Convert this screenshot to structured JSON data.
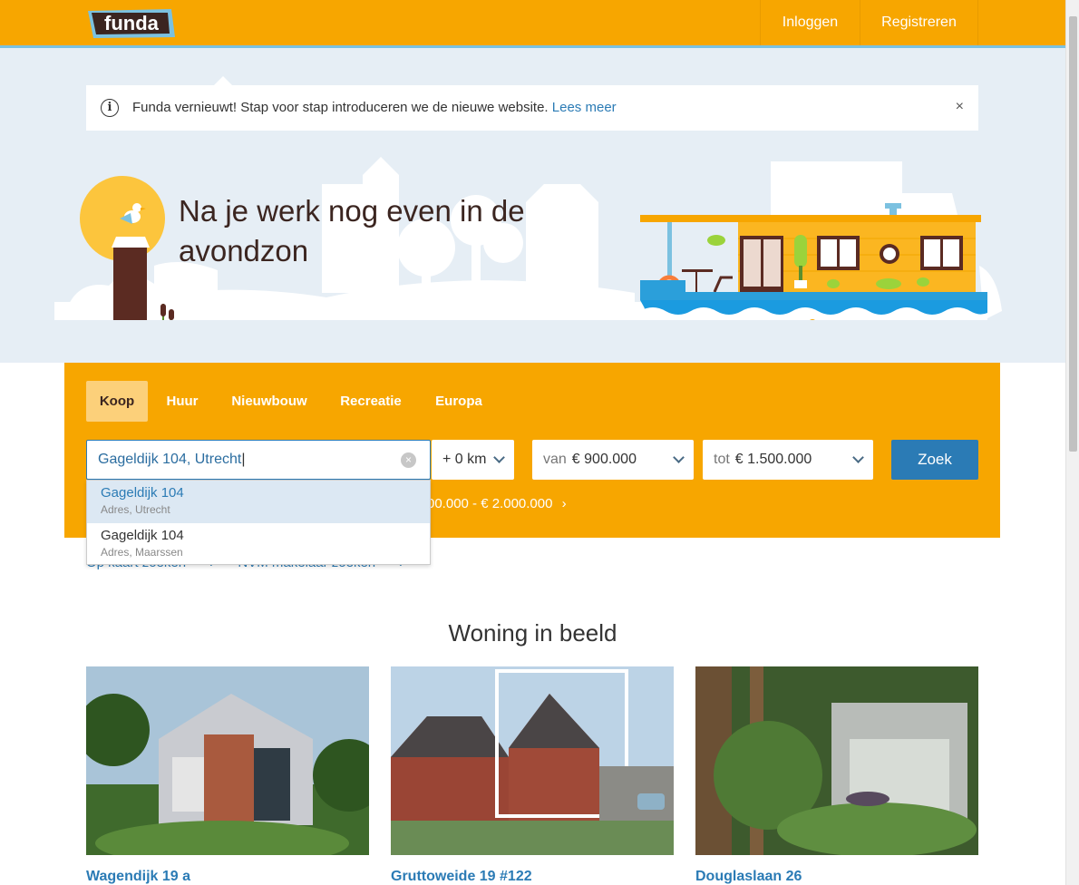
{
  "header": {
    "logo_text": "funda",
    "login_label": "Inloggen",
    "register_label": "Registreren"
  },
  "notice": {
    "text": "Funda vernieuwt! Stap voor stap introduceren we de nieuwe website.",
    "link": "Lees meer",
    "info_glyph": "i",
    "close_glyph": "×"
  },
  "hero": {
    "title": "Na je werk nog even in de avondzon"
  },
  "search": {
    "tabs": [
      {
        "label": "Koop",
        "active": true
      },
      {
        "label": "Huur",
        "active": false
      },
      {
        "label": "Nieuwbouw",
        "active": false
      },
      {
        "label": "Recreatie",
        "active": false
      },
      {
        "label": "Europa",
        "active": false
      }
    ],
    "query": "Gageldijk 104, Utrecht",
    "radius": "+ 0 km",
    "price_from_label": "van",
    "price_from": "€ 900.000",
    "price_to_label": "tot",
    "price_to": "€ 1.500.000",
    "button": "Zoek",
    "saved_search_tail": "00.000 - € 2.000.000",
    "clear_glyph": "×"
  },
  "autocomplete": [
    {
      "title": "Gageldijk 104",
      "subtitle": "Adres, Utrecht"
    },
    {
      "title": "Gageldijk 104",
      "subtitle": "Adres, Maarssen"
    }
  ],
  "links": {
    "map": "Op kaart zoeken",
    "nvm": "NVM makelaar zoeken"
  },
  "section": {
    "title": "Woning in beeld",
    "cards": [
      {
        "title": "Wagendijk 19 a"
      },
      {
        "title": "Gruttoweide 19 #122"
      },
      {
        "title": "Douglaslaan 26"
      }
    ]
  },
  "colors": {
    "brand_orange": "#f7a600",
    "link_blue": "#2b7bb5",
    "hero_bg": "#e6eef5"
  }
}
